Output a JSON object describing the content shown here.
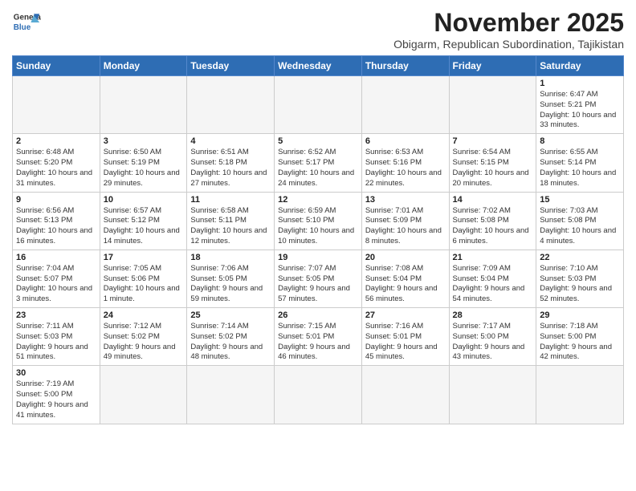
{
  "header": {
    "logo_line1": "General",
    "logo_line2": "Blue",
    "title": "November 2025",
    "subtitle": "Obigarm, Republican Subordination, Tajikistan"
  },
  "days_of_week": [
    "Sunday",
    "Monday",
    "Tuesday",
    "Wednesday",
    "Thursday",
    "Friday",
    "Saturday"
  ],
  "weeks": [
    [
      {
        "day": "",
        "info": ""
      },
      {
        "day": "",
        "info": ""
      },
      {
        "day": "",
        "info": ""
      },
      {
        "day": "",
        "info": ""
      },
      {
        "day": "",
        "info": ""
      },
      {
        "day": "",
        "info": ""
      },
      {
        "day": "1",
        "info": "Sunrise: 6:47 AM\nSunset: 5:21 PM\nDaylight: 10 hours\nand 33 minutes."
      }
    ],
    [
      {
        "day": "2",
        "info": "Sunrise: 6:48 AM\nSunset: 5:20 PM\nDaylight: 10 hours\nand 31 minutes."
      },
      {
        "day": "3",
        "info": "Sunrise: 6:50 AM\nSunset: 5:19 PM\nDaylight: 10 hours\nand 29 minutes."
      },
      {
        "day": "4",
        "info": "Sunrise: 6:51 AM\nSunset: 5:18 PM\nDaylight: 10 hours\nand 27 minutes."
      },
      {
        "day": "5",
        "info": "Sunrise: 6:52 AM\nSunset: 5:17 PM\nDaylight: 10 hours\nand 24 minutes."
      },
      {
        "day": "6",
        "info": "Sunrise: 6:53 AM\nSunset: 5:16 PM\nDaylight: 10 hours\nand 22 minutes."
      },
      {
        "day": "7",
        "info": "Sunrise: 6:54 AM\nSunset: 5:15 PM\nDaylight: 10 hours\nand 20 minutes."
      },
      {
        "day": "8",
        "info": "Sunrise: 6:55 AM\nSunset: 5:14 PM\nDaylight: 10 hours\nand 18 minutes."
      }
    ],
    [
      {
        "day": "9",
        "info": "Sunrise: 6:56 AM\nSunset: 5:13 PM\nDaylight: 10 hours\nand 16 minutes."
      },
      {
        "day": "10",
        "info": "Sunrise: 6:57 AM\nSunset: 5:12 PM\nDaylight: 10 hours\nand 14 minutes."
      },
      {
        "day": "11",
        "info": "Sunrise: 6:58 AM\nSunset: 5:11 PM\nDaylight: 10 hours\nand 12 minutes."
      },
      {
        "day": "12",
        "info": "Sunrise: 6:59 AM\nSunset: 5:10 PM\nDaylight: 10 hours\nand 10 minutes."
      },
      {
        "day": "13",
        "info": "Sunrise: 7:01 AM\nSunset: 5:09 PM\nDaylight: 10 hours\nand 8 minutes."
      },
      {
        "day": "14",
        "info": "Sunrise: 7:02 AM\nSunset: 5:08 PM\nDaylight: 10 hours\nand 6 minutes."
      },
      {
        "day": "15",
        "info": "Sunrise: 7:03 AM\nSunset: 5:08 PM\nDaylight: 10 hours\nand 4 minutes."
      }
    ],
    [
      {
        "day": "16",
        "info": "Sunrise: 7:04 AM\nSunset: 5:07 PM\nDaylight: 10 hours\nand 3 minutes."
      },
      {
        "day": "17",
        "info": "Sunrise: 7:05 AM\nSunset: 5:06 PM\nDaylight: 10 hours\nand 1 minute."
      },
      {
        "day": "18",
        "info": "Sunrise: 7:06 AM\nSunset: 5:05 PM\nDaylight: 9 hours\nand 59 minutes."
      },
      {
        "day": "19",
        "info": "Sunrise: 7:07 AM\nSunset: 5:05 PM\nDaylight: 9 hours\nand 57 minutes."
      },
      {
        "day": "20",
        "info": "Sunrise: 7:08 AM\nSunset: 5:04 PM\nDaylight: 9 hours\nand 56 minutes."
      },
      {
        "day": "21",
        "info": "Sunrise: 7:09 AM\nSunset: 5:04 PM\nDaylight: 9 hours\nand 54 minutes."
      },
      {
        "day": "22",
        "info": "Sunrise: 7:10 AM\nSunset: 5:03 PM\nDaylight: 9 hours\nand 52 minutes."
      }
    ],
    [
      {
        "day": "23",
        "info": "Sunrise: 7:11 AM\nSunset: 5:03 PM\nDaylight: 9 hours\nand 51 minutes."
      },
      {
        "day": "24",
        "info": "Sunrise: 7:12 AM\nSunset: 5:02 PM\nDaylight: 9 hours\nand 49 minutes."
      },
      {
        "day": "25",
        "info": "Sunrise: 7:14 AM\nSunset: 5:02 PM\nDaylight: 9 hours\nand 48 minutes."
      },
      {
        "day": "26",
        "info": "Sunrise: 7:15 AM\nSunset: 5:01 PM\nDaylight: 9 hours\nand 46 minutes."
      },
      {
        "day": "27",
        "info": "Sunrise: 7:16 AM\nSunset: 5:01 PM\nDaylight: 9 hours\nand 45 minutes."
      },
      {
        "day": "28",
        "info": "Sunrise: 7:17 AM\nSunset: 5:00 PM\nDaylight: 9 hours\nand 43 minutes."
      },
      {
        "day": "29",
        "info": "Sunrise: 7:18 AM\nSunset: 5:00 PM\nDaylight: 9 hours\nand 42 minutes."
      }
    ],
    [
      {
        "day": "30",
        "info": "Sunrise: 7:19 AM\nSunset: 5:00 PM\nDaylight: 9 hours\nand 41 minutes."
      },
      {
        "day": "",
        "info": ""
      },
      {
        "day": "",
        "info": ""
      },
      {
        "day": "",
        "info": ""
      },
      {
        "day": "",
        "info": ""
      },
      {
        "day": "",
        "info": ""
      },
      {
        "day": "",
        "info": ""
      }
    ]
  ]
}
